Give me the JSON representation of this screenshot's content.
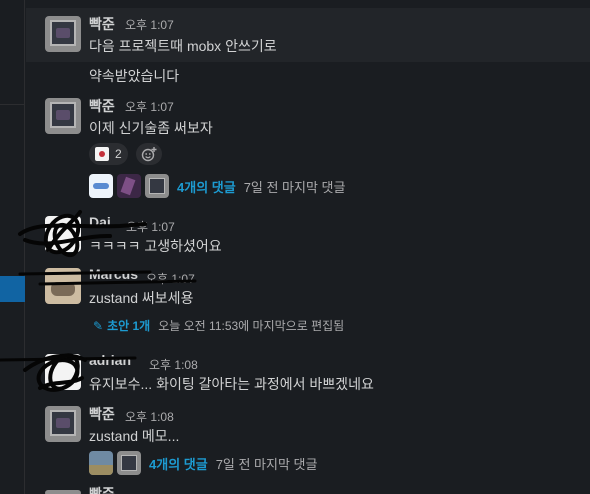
{
  "messages": [
    {
      "name": "빡준",
      "time": "오후 1:07",
      "text": "다음 프로젝트때 mobx 안쓰기로"
    },
    {
      "text": "약속받았습니다"
    },
    {
      "name": "빡준",
      "time": "오후 1:07",
      "text": "이제 신기술좀 써보자",
      "reaction_count": "2",
      "thread_replies": "4개의 댓글",
      "thread_last": "7일 전 마지막 댓글"
    },
    {
      "name": "Dai",
      "time": "오후 1:07",
      "text": "ㅋㅋㅋㅋ 고생하셨어요"
    },
    {
      "name": "Marcus",
      "time": "오후 1:07",
      "text": "zustand 써보세용",
      "draft_label": "초안 1개",
      "draft_meta": "오늘 오전 11:53에 마지막으로 편집됨"
    },
    {
      "name": "adrian",
      "time": "오후 1:08",
      "text": "유지보수... 화이팅 갈아타는 과정에서 바쁘겠네요"
    },
    {
      "name": "빡준",
      "time": "오후 1:08",
      "text": "zustand 메모...",
      "thread_replies": "4개의 댓글",
      "thread_last": "7일 전 마지막 댓글"
    },
    {
      "name": "빡준"
    }
  ],
  "icons": {
    "add_reaction": "add-reaction-icon",
    "pencil": "pencil-icon"
  },
  "colors": {
    "link": "#1d9bd1",
    "active_channel": "#1164a3",
    "background": "#1a1d21"
  }
}
